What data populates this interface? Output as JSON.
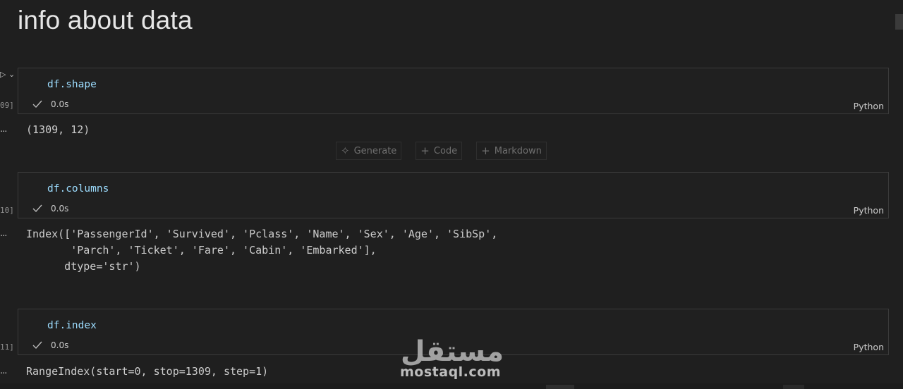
{
  "heading": "info about data",
  "cells": [
    {
      "exec_label": "09]",
      "code": "df.shape",
      "status_time": "0.0s",
      "language": "Python",
      "output_lines": [
        "(1309, 12)"
      ]
    },
    {
      "exec_label": "10]",
      "code": "df.columns",
      "status_time": "0.0s",
      "language": "Python",
      "output_lines": [
        "Index(['PassengerId', 'Survived', 'Pclass', 'Name', 'Sex', 'Age', 'SibSp',",
        "       'Parch', 'Ticket', 'Fare', 'Cabin', 'Embarked'],",
        "      dtype='str')"
      ]
    },
    {
      "exec_label": "11]",
      "code": "df.index",
      "status_time": "0.0s",
      "language": "Python",
      "output_lines": [
        "RangeIndex(start=0, stop=1309, step=1)"
      ]
    }
  ],
  "insert_bar": {
    "generate": "Generate",
    "code": "Code",
    "markdown": "Markdown"
  },
  "gutter": {
    "controls": "▷ ⌄",
    "output_dots": "..."
  },
  "watermark": {
    "arabic": "مستقل",
    "latin": "mostaql.com"
  },
  "colors": {
    "background": "#1f1f1f",
    "cell_border": "#3b3b3b",
    "code_text": "#9cdcfe"
  }
}
